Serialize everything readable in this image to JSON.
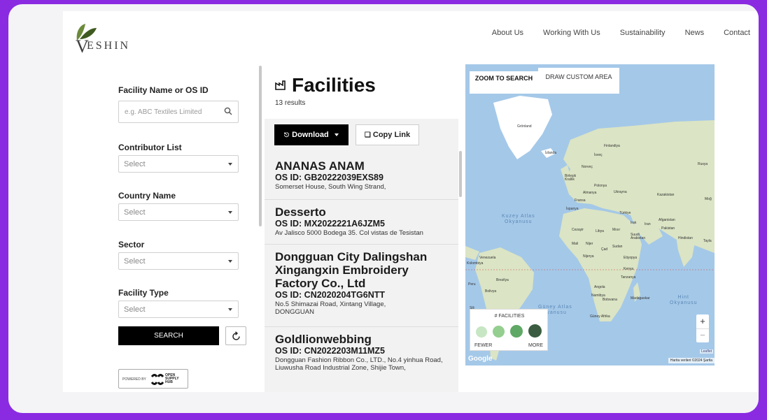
{
  "brand": {
    "name": "ESHIN",
    "initial": "V",
    "accent": "#8a2be2",
    "leaf_colors": [
      "#6b8a3a",
      "#3f5a20"
    ]
  },
  "nav": {
    "items": [
      "About Us",
      "Working With Us",
      "Sustainability",
      "News",
      "Contact"
    ]
  },
  "filters": {
    "facility_label": "Facility Name or OS ID",
    "facility_placeholder": "e.g. ABC Textiles Limited",
    "contributor_label": "Contributor List",
    "country_label": "Country Name",
    "sector_label": "Sector",
    "type_label": "Facility Type",
    "select_placeholder": "Select",
    "search_label": "SEARCH",
    "powered_by": "POWERED BY",
    "osh_name_line1": "OPEN",
    "osh_name_line2": "SUPPLY",
    "osh_name_line3": "HUB"
  },
  "results": {
    "title": "Facilities",
    "count": "13 results",
    "download_label": "Download",
    "copy_label": "Copy Link",
    "items": [
      {
        "name": "ANANAS ANAM",
        "os_id": "OS ID: GB20222039EXS89",
        "address": "Somerset House, South Wing Strand,"
      },
      {
        "name": "Desserto",
        "os_id": "OS ID: MX2022221A6JZM5",
        "address": "Av Jalisco 5000 Bodega 35. Col vistas de Tesistan"
      },
      {
        "name": "Dongguan City Dalingshan Xingangxin Embroidery Factory Co., Ltd",
        "os_id": "OS ID: CN2020204TG6NTT",
        "address": "No.5 Shimazai Road, Xintang Village, DONGGUAN"
      },
      {
        "name": "Goldlionwebbing",
        "os_id": "OS ID: CN2022203M11MZ5",
        "address": "Dongguan Fashion Ribbon Co., LTD., No.4 yinhua Road, Liuwusha Road Industrial Zone, Shijie Town,"
      }
    ]
  },
  "map": {
    "zoom_tab": "ZOOM TO SEARCH",
    "draw_tab": "DRAW CUSTOM AREA",
    "ocean_color": "#a4c8e8",
    "land_color": "#dbe4c4",
    "labels": {
      "gronland": "Grönland",
      "izlanda": "İzlanda",
      "isvec": "İsveç",
      "finlandiya": "Finlandiya",
      "rusya": "Rusya",
      "norvec": "Norveç",
      "birlesik_krallik": "Birleşik Krallık",
      "polonya": "Polonya",
      "almanya": "Almanya",
      "ukrayna": "Ukrayna",
      "kazakistan": "Kazakistan",
      "mogolistan": "Moğ",
      "fransa": "Fransa",
      "ispanya": "İspanya",
      "turkiye": "Türkiye",
      "irak": "Irak",
      "iran": "Iran",
      "afganistan": "Afganistan",
      "pakistan": "Pakistan",
      "cezayir": "Cezayir",
      "libya": "Libya",
      "misir": "Mısır",
      "suudi": "Suudi Arabistan",
      "hindistan": "Hindistan",
      "tayland": "Tayla",
      "mali": "Mali",
      "nijer": "Nijer",
      "cad": "Çad",
      "sudan": "Sudan",
      "etiyopya": "Etiyopya",
      "nijerya": "Nijerya",
      "venezuela": "Venezuela",
      "kolombiya": "Kolombiya",
      "kenya": "Kenya",
      "tanzanya": "Tanzanya",
      "peru": "Peru",
      "brezilya": "Brezilya",
      "bolivya": "Bolivya",
      "angola": "Angola",
      "namibya": "Namibya",
      "botsvana": "Botsvana",
      "madagaskar": "Madagaskar",
      "guney_afrika": "Güney Afrika",
      "sili": "Şili"
    },
    "oceans": {
      "atlantic_north": "Kuzey Atlas\nOkyanusu",
      "atlantic_south": "Güney Atlas\nkyanusu",
      "indian": "Hint\nOkyanusu"
    },
    "legend": {
      "title": "# FACILITIES",
      "fewer": "FEWER",
      "more": "MORE",
      "colors": [
        "#c7e6c3",
        "#94cf8f",
        "#5fa865",
        "#3b5c40"
      ]
    },
    "leaflet": "Leaflet",
    "google": "Google",
    "attribution": "Harita verileri ©2024   Şartla"
  }
}
